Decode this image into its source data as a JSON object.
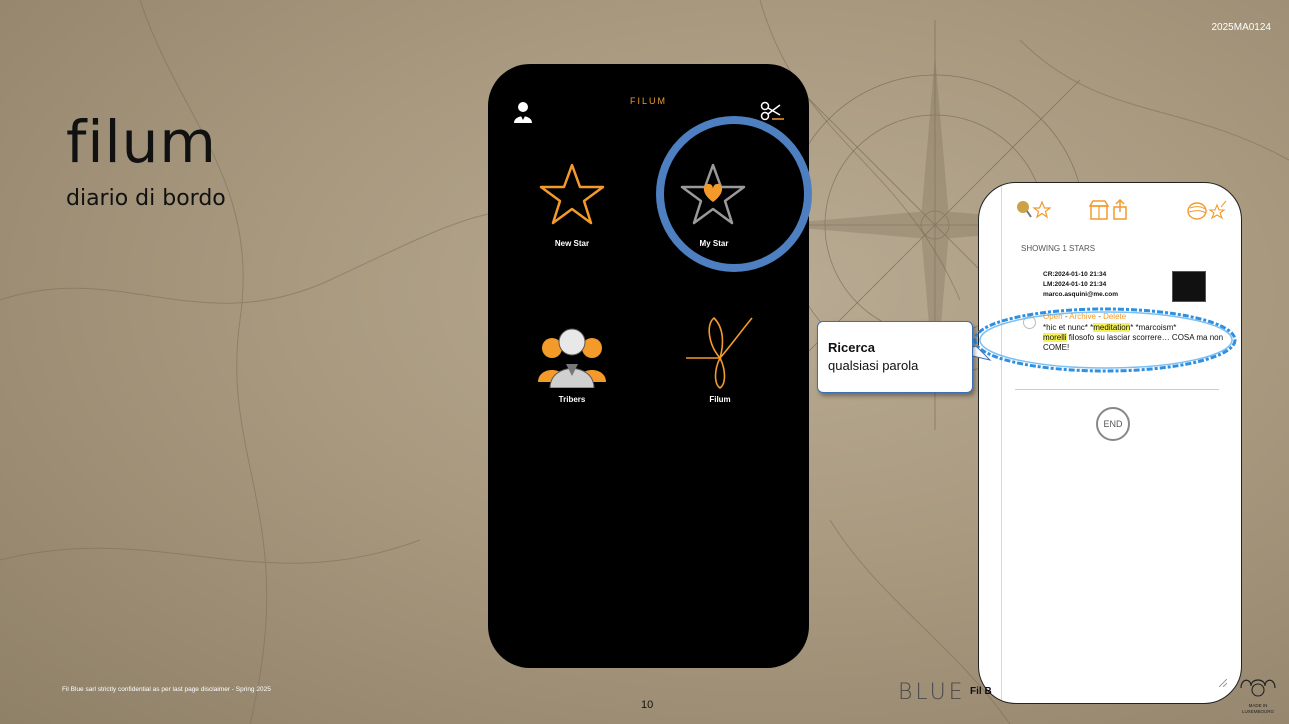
{
  "slide": {
    "code": "2025MA0124",
    "title": "filum",
    "subtitle": "diario di bordo",
    "footer_note": "Fil Blue sarl strictly confidential as per last page disclaimer - Spring 2025",
    "page_number": "10",
    "watermark_blue": "BLUE",
    "watermark_fil": "Fil B",
    "logo_text": "MADE IN LUXEMBOURG"
  },
  "colors": {
    "accent_orange": "#f39a2b",
    "ring_blue": "#4e7fc0",
    "highlight": "#f6f25a"
  },
  "phone_home": {
    "app_title": "FILUM",
    "top_left_icon": "user-icon",
    "top_right_icon": "scissors-icon",
    "tiles": [
      {
        "label": "New Star",
        "icon": "star-outline-icon"
      },
      {
        "label": "My Star",
        "icon": "star-heart-icon"
      },
      {
        "label": "Tribers",
        "icon": "people-group-icon"
      },
      {
        "label": "Filum",
        "icon": "thread-knot-icon"
      }
    ]
  },
  "phone_list": {
    "showing": "SHOWING 1 STARS",
    "entry": {
      "cr": "CR:2024-01-10 21:34",
      "lm": "LM:2024-01-10 21:34",
      "email": "marco.asquini@me.com",
      "actions": [
        "Open",
        "Archive",
        "Delete"
      ],
      "text_parts": [
        "*hic et nunc* *",
        "meditation",
        "* *marcoism*",
        "morelli",
        " filosofo su lasciar scorrere… COSA ma non COME!"
      ]
    },
    "end_label": "END"
  },
  "callout": {
    "title": "Ricerca",
    "subtitle": "qualsiasi parola"
  }
}
